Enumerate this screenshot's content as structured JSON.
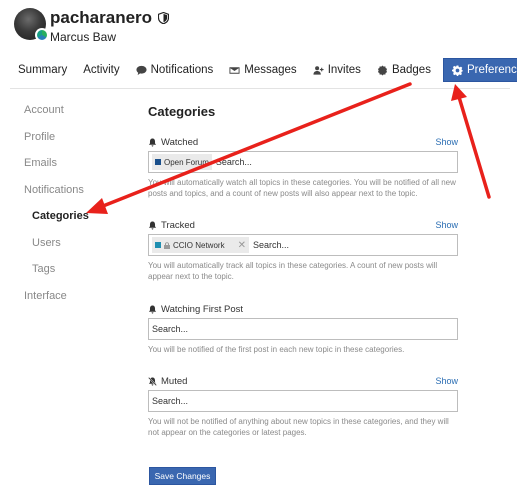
{
  "header": {
    "username": "pacharanero",
    "full_name": "Marcus Baw"
  },
  "nav": {
    "tabs": [
      {
        "label": "Summary",
        "icon": ""
      },
      {
        "label": "Activity",
        "icon": ""
      },
      {
        "label": "Notifications",
        "icon": "comment-icon"
      },
      {
        "label": "Messages",
        "icon": "envelope-icon"
      },
      {
        "label": "Invites",
        "icon": "user-plus-icon"
      },
      {
        "label": "Badges",
        "icon": "certificate-icon"
      },
      {
        "label": "Preferences",
        "icon": "cog-icon"
      }
    ],
    "active": "Preferences"
  },
  "sidebar": {
    "items": [
      {
        "label": "Account"
      },
      {
        "label": "Profile"
      },
      {
        "label": "Emails"
      },
      {
        "label": "Notifications"
      },
      {
        "label": "Categories"
      },
      {
        "label": "Users"
      },
      {
        "label": "Tags"
      },
      {
        "label": "Interface"
      }
    ],
    "active": "Categories"
  },
  "main": {
    "title": "Categories",
    "sections": [
      {
        "label": "Watched",
        "icon": "bell-icon",
        "show_label": "Show",
        "chip": {
          "name": "Open Forum",
          "color": "#1a4f8b"
        },
        "placeholder": "Search...",
        "help": "You will automatically watch all topics in these categories. You will be notified of all new posts and topics, and a count of new posts will also appear next to the topic."
      },
      {
        "label": "Tracked",
        "icon": "bell-icon",
        "show_label": "Show",
        "chip": {
          "name": "CCIO Network",
          "color": "#1f8fb1"
        },
        "placeholder": "Search...",
        "help": "You will automatically track all topics in these categories. A count of new posts will appear next to the topic."
      },
      {
        "label": "Watching First Post",
        "icon": "bell-icon",
        "placeholder": "Search...",
        "help": "You will be notified of the first post in each new topic in these categories."
      },
      {
        "label": "Muted",
        "icon": "bell-slash-icon",
        "show_label": "Show",
        "placeholder": "Search...",
        "help": "You will not be notified of anything about new topics in these categories, and they will not appear on the categories or latest pages."
      }
    ],
    "save_label": "Save Changes"
  },
  "colors": {
    "accent": "#3a67b0",
    "link": "#2a6db3",
    "annotation_arrow": "#e8211b"
  }
}
